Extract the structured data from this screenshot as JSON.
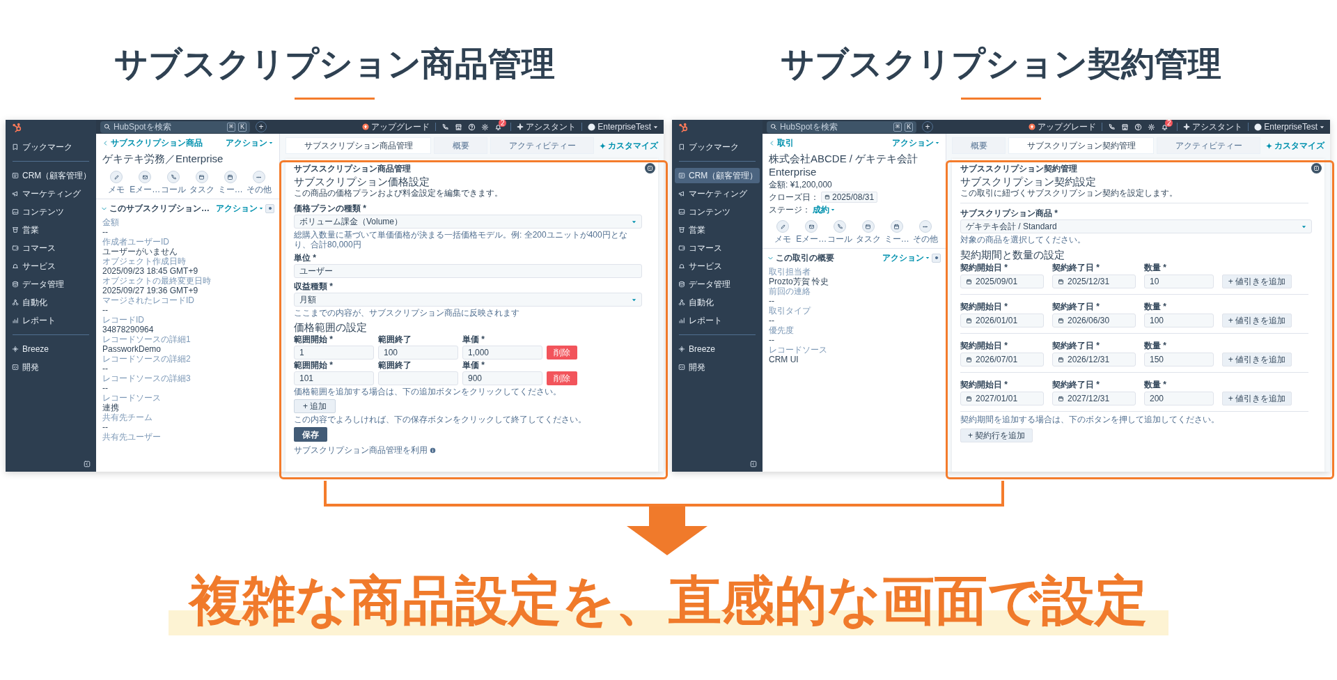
{
  "headlines": [
    {
      "text": "サブスクリプション商品管理"
    },
    {
      "text": "サブスクリプション契約管理"
    }
  ],
  "screens": [
    {
      "top_bar": {
        "search_placeholder": "HubSpotを検索",
        "shortcut": [
          "⌘",
          "K"
        ],
        "new_button": "+",
        "upgrade": "アップグレード",
        "notifications": "2",
        "assistant": "アシスタント",
        "account": "EnterpriseTest"
      },
      "sidebar": {
        "groups": [
          [
            {
              "label": "ブックマーク",
              "selected": false
            }
          ],
          [
            {
              "label": "CRM（顧客管理）",
              "selected": false
            },
            {
              "label": "マーケティング",
              "selected": false
            },
            {
              "label": "コンテンツ",
              "selected": false
            },
            {
              "label": "営業",
              "selected": false
            },
            {
              "label": "コマース",
              "selected": false
            },
            {
              "label": "サービス",
              "selected": false
            },
            {
              "label": "データ管理",
              "selected": false
            },
            {
              "label": "自動化",
              "selected": false
            },
            {
              "label": "レポート",
              "selected": false
            }
          ],
          [
            {
              "label": "Breeze",
              "selected": false
            },
            {
              "label": "開発",
              "selected": false
            }
          ]
        ]
      },
      "record": {
        "back_link": "サブスクリプション商品",
        "actions": "アクション",
        "title": "ゲキテキ労務／Enterprise",
        "quick_actions": [
          "メモ",
          "Eメー…",
          "コール",
          "タスク",
          "ミー…",
          "その他"
        ],
        "section": {
          "title": "このサブスクリプション…",
          "actions": "アクション",
          "properties": [
            {
              "label": "金額",
              "value": "--"
            },
            {
              "label": "作成者ユーザーID",
              "value": "ユーザーがいません"
            },
            {
              "label": "オブジェクト作成日時",
              "value": "2025/09/23 18:45 GMT+9"
            },
            {
              "label": "オブジェクトの最終変更日時",
              "value": "2025/09/27 19:36 GMT+9"
            },
            {
              "label": "マージされたレコードID",
              "value": "--"
            },
            {
              "label": "レコードID",
              "value": "34878290964"
            },
            {
              "label": "レコードソースの詳細1",
              "value": "PassworkDemo"
            },
            {
              "label": "レコードソースの詳細2",
              "value": "--"
            },
            {
              "label": "レコードソースの詳細3",
              "value": "--"
            },
            {
              "label": "レコードソース",
              "value": "連携"
            },
            {
              "label": "共有先チーム",
              "value": "--"
            },
            {
              "label": "共有先ユーザー"
            }
          ]
        }
      },
      "tabs": [
        {
          "label": "サブスクリプション商品管理",
          "selected": true
        },
        {
          "label": "概要",
          "selected": false
        },
        {
          "label": "アクティビティー",
          "selected": false
        }
      ],
      "customize": "カスタマイズ",
      "form": {
        "kind": "pricing",
        "card_label": "サブススクリプション商品管理",
        "title": "サブスクリプション価格設定",
        "subtitle": "この商品の価格プランおよび料金設定を編集できます。",
        "fields": [
          {
            "kind": "select",
            "label": "価格プランの種類 *",
            "value": "ボリューム課金（Volume）",
            "help": "総購入数量に基づいて単価価格が決まる一括価格モデル。例: 全200ユニットが400円となり、合計80,000円"
          },
          {
            "kind": "text",
            "label": "単位 *",
            "value": "ユーザー"
          },
          {
            "kind": "select",
            "label": "収益種類 *",
            "value": "月額",
            "help": "ここまでの内容が、サブスクリプション商品に反映されます"
          }
        ],
        "section_title": "価格範囲の設定",
        "ranges": [
          {
            "start_label": "範囲開始 *",
            "start": "1",
            "end_label": "範囲終了",
            "end": "100",
            "price_label": "単価 *",
            "price": "1,000",
            "delete": "削除"
          },
          {
            "start_label": "範囲開始 *",
            "start": "101",
            "end_label": "範囲終了",
            "price_label": "単価 *",
            "price": "900",
            "delete": "削除"
          }
        ],
        "range_help": "価格範囲を追加する場合は、下の追加ボタンをクリックしてください。",
        "add_button": "+ 追加",
        "save_help": "この内容でよろしければ、下の保存ボタンをクリックして終了してください。",
        "save_button": "保存",
        "footer": "サブスクリプション商品管理を利用"
      }
    },
    {
      "top_bar": {
        "search_placeholder": "HubSpotを検索",
        "shortcut": [
          "⌘",
          "K"
        ],
        "new_button": "+",
        "upgrade": "アップグレード",
        "notifications": "2",
        "assistant": "アシスタント",
        "account": "EnterpriseTest"
      },
      "sidebar": {
        "groups": [
          [
            {
              "label": "ブックマーク",
              "selected": false
            }
          ],
          [
            {
              "label": "CRM（顧客管理）",
              "selected": true
            },
            {
              "label": "マーケティング",
              "selected": false
            },
            {
              "label": "コンテンツ",
              "selected": false
            },
            {
              "label": "営業",
              "selected": false
            },
            {
              "label": "コマース",
              "selected": false
            },
            {
              "label": "サービス",
              "selected": false
            },
            {
              "label": "データ管理",
              "selected": false
            },
            {
              "label": "自動化",
              "selected": false
            },
            {
              "label": "レポート",
              "selected": false
            }
          ],
          [
            {
              "label": "Breeze",
              "selected": false
            },
            {
              "label": "開発",
              "selected": false
            }
          ]
        ]
      },
      "record": {
        "back_link": "取引",
        "actions": "アクション",
        "title": "株式会社ABCDE / ゲキテキ会計Enterprise",
        "summary": {
          "amount": "金額: ¥1,200,000",
          "close_date_label": "クローズ日：",
          "close_date": "2025/08/31",
          "stage_label": "ステージ：",
          "stage": "成約"
        },
        "quick_actions": [
          "メモ",
          "Eメー…",
          "コール",
          "タスク",
          "ミー…",
          "その他"
        ],
        "section": {
          "title": "この取引の概要",
          "actions": "アクション",
          "properties": [
            {
              "label": "取引担当者",
              "value": "Prozto芳賀 怜史"
            },
            {
              "label": "前回の連絡",
              "value": "--"
            },
            {
              "label": "取引タイプ",
              "value": "--"
            },
            {
              "label": "優先度",
              "value": "--"
            },
            {
              "label": "レコードソース",
              "value": "CRM UI"
            }
          ]
        }
      },
      "tabs": [
        {
          "label": "概要",
          "selected": false
        },
        {
          "label": "サブスクリプション契約管理",
          "selected": true
        },
        {
          "label": "アクティビティー",
          "selected": false
        }
      ],
      "customize": "カスタマイズ",
      "form": {
        "kind": "contract",
        "card_label": "サブススクリプション契約管理",
        "title": "サブスクリプション契約設定",
        "subtitle": "この取引に紐づくサブスクリプション契約を設定します。",
        "product_field": {
          "label": "サブスクリプション商品 *",
          "value": "ゲキテキ会計 / Standard",
          "help": "対象の商品を選択してください。"
        },
        "section_title": "契約期間と数量の設定",
        "periods": [
          {
            "start_label": "契約開始日 *",
            "start": "2025/09/01",
            "end_label": "契約終了日 *",
            "end": "2025/12/31",
            "qty_label": "数量 *",
            "qty": "10",
            "discount_button": "+ 値引きを追加"
          },
          {
            "start_label": "契約開始日 *",
            "start": "2026/01/01",
            "end_label": "契約終了日 *",
            "end": "2026/06/30",
            "qty_label": "数量 *",
            "qty": "100",
            "discount_button": "+ 値引きを追加"
          },
          {
            "start_label": "契約開始日 *",
            "start": "2026/07/01",
            "end_label": "契約終了日 *",
            "end": "2026/12/31",
            "qty_label": "数量 *",
            "qty": "150",
            "discount_button": "+ 値引きを追加"
          },
          {
            "start_label": "契約開始日 *",
            "start": "2027/01/01",
            "end_label": "契約終了日 *",
            "end": "2027/12/31",
            "qty_label": "数量 *",
            "qty": "200",
            "discount_button": "+ 値引きを追加"
          }
        ],
        "periods_help": "契約期間を追加する場合は、下のボタンを押して追加してください。",
        "add_button": "+ 契約行を追加"
      }
    }
  ],
  "tagline": "複雑な商品設定を、直感的な画面で設定"
}
